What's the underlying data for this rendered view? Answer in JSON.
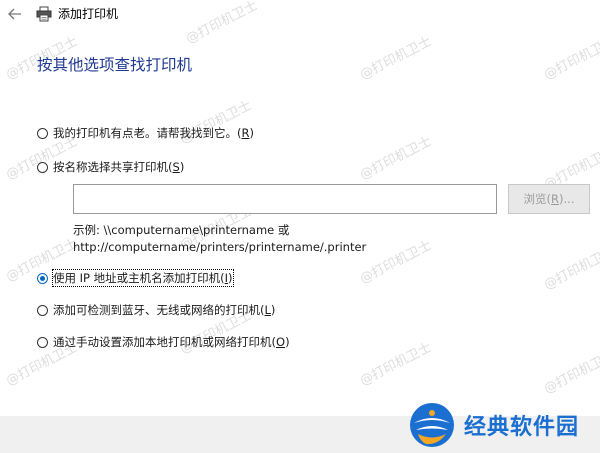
{
  "window": {
    "title": "添加打印机"
  },
  "page": {
    "heading": "按其他选项查找打印机"
  },
  "options": [
    {
      "label": "我的打印机有点老。请帮我找到它。",
      "hotkey": "R",
      "checked": false
    },
    {
      "label": "按名称选择共享打印机",
      "hotkey": "S",
      "checked": false
    },
    {
      "label": "使用 IP 地址或主机名添加打印机",
      "hotkey": "I",
      "checked": true
    },
    {
      "label": "添加可检测到蓝牙、无线或网络的打印机",
      "hotkey": "L",
      "checked": false
    },
    {
      "label": "通过手动设置添加本地打印机或网络打印机",
      "hotkey": "O",
      "checked": false
    }
  ],
  "share_input": {
    "value": "",
    "placeholder": ""
  },
  "browse_button": {
    "label_before": "浏览(",
    "hotkey": "R",
    "label_after": ")..."
  },
  "example": {
    "line1": "示例: \\\\computername\\printername 或",
    "line2": "http://computername/printers/printername/.printer"
  },
  "watermark": {
    "text": "@打印机卫士"
  },
  "brand": {
    "name": "经典软件园",
    "color": "#1b6fd1"
  },
  "icons": {
    "back": "arrow-left-icon",
    "printer": "printer-icon",
    "brand": "brand-logo-icon"
  },
  "colors": {
    "heading": "#1f3a93",
    "radio_selected": "#0067c0",
    "footer_bg": "#f0f0f0"
  }
}
